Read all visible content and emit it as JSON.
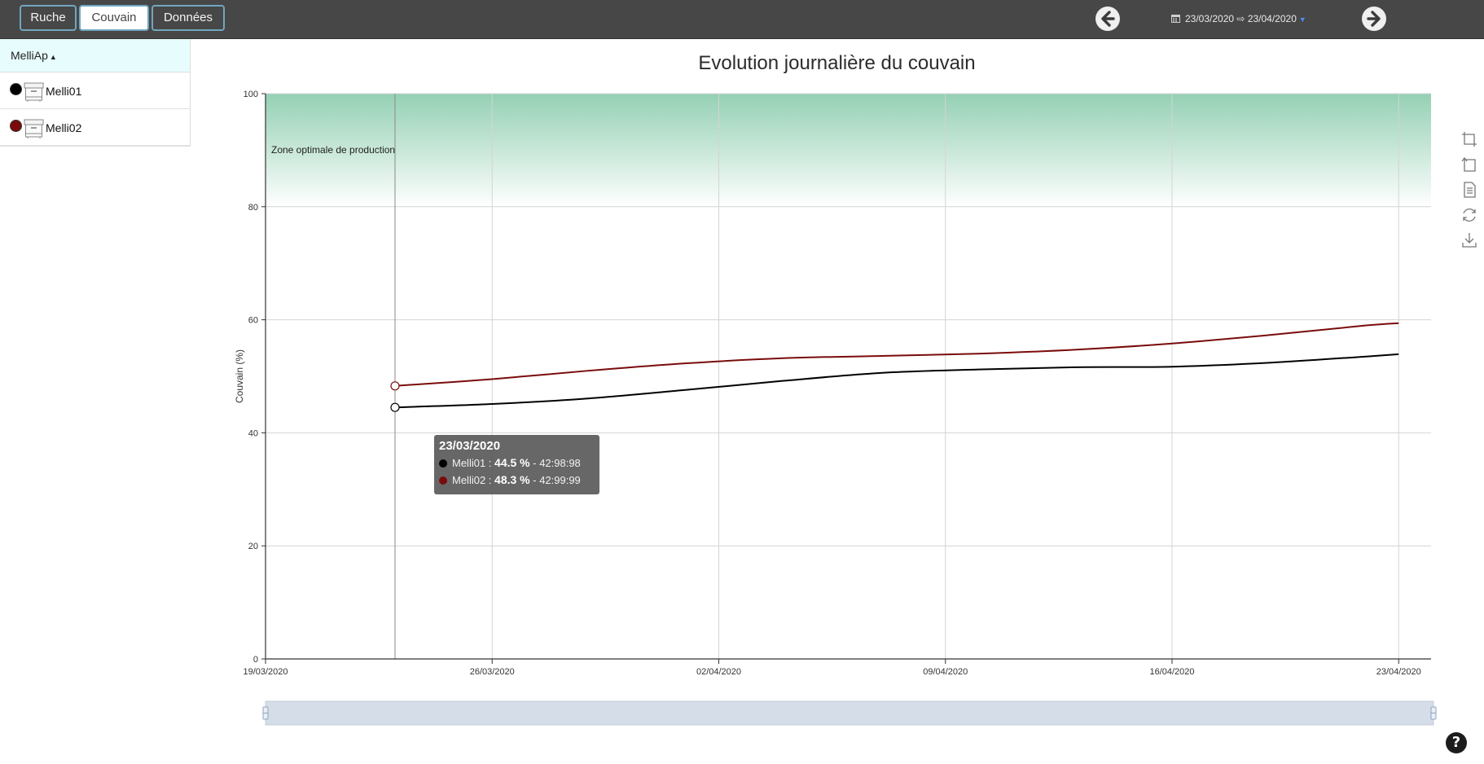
{
  "tabs": [
    {
      "label": "Ruche",
      "active": false
    },
    {
      "label": "Couvain",
      "active": true
    },
    {
      "label": "Données",
      "active": false
    }
  ],
  "date_range": {
    "start": "23/03/2020",
    "arrow": "⇨",
    "end": "23/04/2020"
  },
  "sidebar": {
    "header": "MelliAp",
    "items": [
      {
        "name": "Melli01",
        "color": "#000000"
      },
      {
        "name": "Melli02",
        "color": "#7a0b0b"
      }
    ]
  },
  "chart_data": {
    "type": "line",
    "title": "Evolution journalière du couvain",
    "ylabel": "Couvain (%)",
    "xlabel": "",
    "ylim": [
      0,
      100
    ],
    "yticks": [
      0,
      20,
      40,
      60,
      80,
      100
    ],
    "xlim": [
      "19/03/2020",
      "24/04/2020"
    ],
    "xticks": [
      "19/03/2020",
      "26/03/2020",
      "02/04/2020",
      "09/04/2020",
      "16/04/2020",
      "23/04/2020"
    ],
    "grid": true,
    "band": {
      "from": 80,
      "to": 100,
      "label": "Zone optimale de production"
    },
    "series": [
      {
        "name": "Melli01",
        "color": "#000000",
        "x": [
          "23/03/2020",
          "26/03/2020",
          "29/03/2020",
          "01/04/2020",
          "04/04/2020",
          "07/04/2020",
          "10/04/2020",
          "13/04/2020",
          "16/04/2020",
          "19/04/2020",
          "22/04/2020",
          "23/04/2020"
        ],
        "values": [
          44.5,
          45.1,
          46.1,
          47.6,
          49.2,
          50.6,
          51.2,
          51.6,
          51.7,
          52.4,
          53.5,
          53.9
        ]
      },
      {
        "name": "Melli02",
        "color": "#7a0b0b",
        "x": [
          "23/03/2020",
          "26/03/2020",
          "29/03/2020",
          "01/04/2020",
          "04/04/2020",
          "07/04/2020",
          "10/04/2020",
          "13/04/2020",
          "16/04/2020",
          "19/04/2020",
          "22/04/2020",
          "23/04/2020"
        ],
        "values": [
          48.3,
          49.5,
          51.0,
          52.3,
          53.2,
          53.6,
          54.0,
          54.7,
          55.8,
          57.3,
          59.0,
          59.4
        ]
      }
    ],
    "tooltip": {
      "date": "23/03/2020",
      "rows": [
        {
          "name": "Melli01",
          "value": "44.5 %",
          "extra": "42:98:98",
          "color": "#000000"
        },
        {
          "name": "Melli02",
          "value": "48.3 %",
          "extra": "42:99:99",
          "color": "#7a0b0b"
        }
      ]
    }
  },
  "toolbox": [
    "zoom-icon",
    "zoom-reset-icon",
    "data-view-icon",
    "restore-icon",
    "download-icon"
  ],
  "help": "?"
}
